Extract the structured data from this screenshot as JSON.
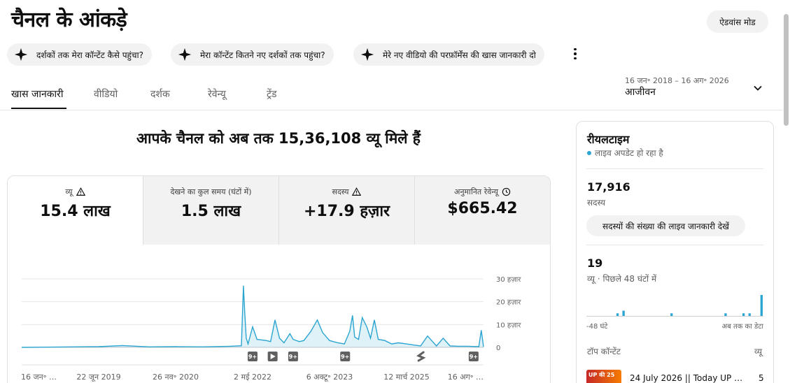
{
  "page": {
    "title": "चैनल के आंकड़े",
    "advanced_mode_label": "ऐडवांस मोड"
  },
  "suggestion_chips": [
    {
      "label": "दर्शकों तक मेरा कॉन्टेंट कैसे पहुंचा?",
      "icon": "sparkle-icon"
    },
    {
      "label": "मेरा कॉन्टेंट कितने नए दर्शकों तक पहुंचा?",
      "icon": "sparkle-icon"
    },
    {
      "label": "मेरे नए वीडियो की परफ़ॉर्मेंस की खास जानकारी दो",
      "icon": "sparkle-icon"
    }
  ],
  "tabs": [
    {
      "label": "खास जानकारी",
      "active": true
    },
    {
      "label": "वीडियो",
      "active": false
    },
    {
      "label": "दर्शक",
      "active": false
    },
    {
      "label": "रेवेन्यू",
      "active": false
    },
    {
      "label": "ट्रेंड",
      "active": false
    }
  ],
  "date_range": {
    "range": "16 जन॰ 2018 – 16 अग॰ 2026",
    "label": "आजीवन"
  },
  "headline": "आपके चैनल को अब तक 15,36,108 व्यू मिले हैं",
  "metrics": [
    {
      "label": "व्यू",
      "value": "15.4 लाख",
      "icon": "warning-icon",
      "selected": true
    },
    {
      "label": "देखने का कुल समय (घंटों में)",
      "value": "1.5 लाख",
      "icon": "",
      "selected": false
    },
    {
      "label": "सदस्य",
      "value": "+17.9 हज़ार",
      "icon": "warning-icon",
      "selected": false
    },
    {
      "label": "अनुमानित रेवेन्यू",
      "value": "$665.42",
      "icon": "clock-icon",
      "selected": false
    }
  ],
  "chart_data": {
    "type": "line",
    "series": [
      {
        "x": [
          "2018-01-16",
          "2018-07-01",
          "2019-01-01",
          "2019-06-22",
          "2019-12-01",
          "2020-06-01",
          "2020-11-26",
          "2021-06-01",
          "2021-12-01",
          "2022-02-15",
          "2022-03-01",
          "2022-03-10",
          "2022-03-20",
          "2022-04-01",
          "2022-05-02",
          "2022-06-01",
          "2022-08-01",
          "2022-09-01",
          "2022-10-01",
          "2022-11-01",
          "2022-12-01",
          "2023-01-10",
          "2023-02-01",
          "2023-03-15",
          "2023-04-15",
          "2023-06-01",
          "2023-07-15",
          "2023-08-20",
          "2023-10-06",
          "2023-12-01",
          "2024-01-15",
          "2024-02-20",
          "2024-03-10",
          "2024-03-25",
          "2024-04-20",
          "2024-05-15",
          "2024-06-15",
          "2024-07-10",
          "2024-08-05",
          "2024-09-01",
          "2024-10-15",
          "2024-12-01",
          "2025-01-15",
          "2025-03-12",
          "2025-05-01",
          "2025-06-15",
          "2025-08-01",
          "2025-10-01",
          "2025-11-15",
          "2026-01-01",
          "2026-03-01",
          "2026-05-01",
          "2026-07-15",
          "2026-08-01",
          "2026-08-16"
        ],
        "values": [
          0,
          100,
          200,
          300,
          800,
          200,
          300,
          200,
          500,
          700,
          27000,
          15000,
          4000,
          1500,
          9000,
          3500,
          3000,
          2500,
          12000,
          4000,
          2000,
          6000,
          3500,
          2500,
          3000,
          7000,
          12000,
          6500,
          3000,
          2000,
          1500,
          7000,
          14000,
          4500,
          3500,
          13000,
          9000,
          4000,
          12000,
          3500,
          3000,
          1500,
          2000,
          1500,
          1000,
          600,
          5000,
          600,
          4000,
          600,
          500,
          500,
          300,
          7500,
          200
        ]
      }
    ],
    "y_ticks": [
      "30 हज़ार",
      "20 हज़ार",
      "10 हज़ार",
      "0"
    ],
    "x_tick_labels": [
      "16 जन॰ …",
      "22 जून 2019",
      "26 नव॰ 2020",
      "2 मई 2022",
      "6 अक्टू॰ 2023",
      "12 मार्च 2025",
      "16 अग॰ …"
    ],
    "ylim": [
      0,
      30000
    ],
    "grid": true,
    "markers": [
      {
        "label": "9+",
        "at": "2022-05-02"
      },
      {
        "label": "play",
        "at": "2022-09-15"
      },
      {
        "label": "9+",
        "at": "2023-02-01"
      },
      {
        "label": "9+",
        "at": "2024-01-20"
      },
      {
        "label": "shorts",
        "at": "2025-06-20"
      },
      {
        "label": "9+",
        "at": "2026-06-10"
      }
    ]
  },
  "realtime": {
    "title": "रीयलटाइम",
    "live_text": "लाइव अपडेट हो रहा है",
    "subscribers_count": "17,916",
    "subscribers_label": "सदस्य",
    "live_button": "सदस्यों की संख्या की लाइव जानकारी देखें",
    "views_count": "19",
    "views_label": "व्यू · पिछले 48 घंटों में",
    "bars": [
      0,
      0,
      0,
      0,
      0,
      0,
      0,
      0,
      0,
      0,
      1,
      0,
      2,
      0,
      0,
      0,
      0,
      0,
      0,
      0,
      0,
      0,
      0,
      0,
      0,
      0,
      0,
      0,
      1,
      0,
      0,
      0,
      0,
      0,
      0,
      0,
      0,
      0,
      0,
      0,
      0,
      0,
      0,
      0,
      0,
      0,
      1,
      0,
      0,
      0,
      0,
      0,
      1,
      0,
      1,
      0,
      0,
      0,
      8
    ],
    "axis_left": "-48 घंटे",
    "axis_right": "अब तक का डेटा",
    "top_content_label": "टॉप कॉन्टेंट",
    "top_views_label": "व्यू",
    "top_video": {
      "title": "24 July 2026 || Today UP N…",
      "views": "5",
      "thumb_text": "UP की 25"
    }
  }
}
